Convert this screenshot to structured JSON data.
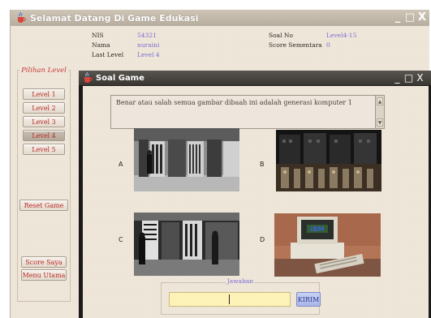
{
  "main_window": {
    "title": "Selamat Datang Di Game Edukasi",
    "controls": {
      "minimize": "_",
      "maximize": "□",
      "close": "X"
    }
  },
  "player_info": {
    "nis_label": "NIS",
    "nis_value": "54321",
    "nama_label": "Nama",
    "nama_value": "nuraini",
    "last_level_label": "Last Level",
    "last_level_value": "Level 4",
    "soal_no_label": "Soal No",
    "soal_no_value": "Level4-15",
    "score_label": "Score Sementara",
    "score_value": "0"
  },
  "level_panel": {
    "title": "Pilihan Level",
    "levels": [
      {
        "label": "Level 1",
        "active": false
      },
      {
        "label": "Level 2",
        "active": false
      },
      {
        "label": "Level 3",
        "active": false
      },
      {
        "label": "Level 4",
        "active": true
      },
      {
        "label": "Level 5",
        "active": false
      }
    ],
    "reset_label": "Reset Game",
    "score_label": "Score Saya",
    "menu_label": "Menu Utama"
  },
  "soal_dialog": {
    "title": "Soal Game",
    "controls": {
      "minimize": "_",
      "maximize": "□",
      "close": "X"
    },
    "question": "Benar atau salah semua gambar dibaah ini adalah generasi komputer 1",
    "options": [
      {
        "letter": "A",
        "image": "early-mainframe-computer-photo"
      },
      {
        "letter": "B",
        "image": "vacuum-tube-computer-racks-photo"
      },
      {
        "letter": "C",
        "image": "eniac-operators-photo"
      },
      {
        "letter": "D",
        "image": "ibm-personal-computer-photo"
      }
    ],
    "answer_title": "Jawaban",
    "answer_value": "",
    "submit_label": "KIRIM",
    "ibm_logo": "IBM"
  },
  "colors": {
    "window_bg": "#efe6da",
    "button_text": "#b82a28",
    "value_text": "#7a6ccf",
    "answer_bg": "#fdf3b8",
    "submit_bg": "#a9b6e8"
  }
}
